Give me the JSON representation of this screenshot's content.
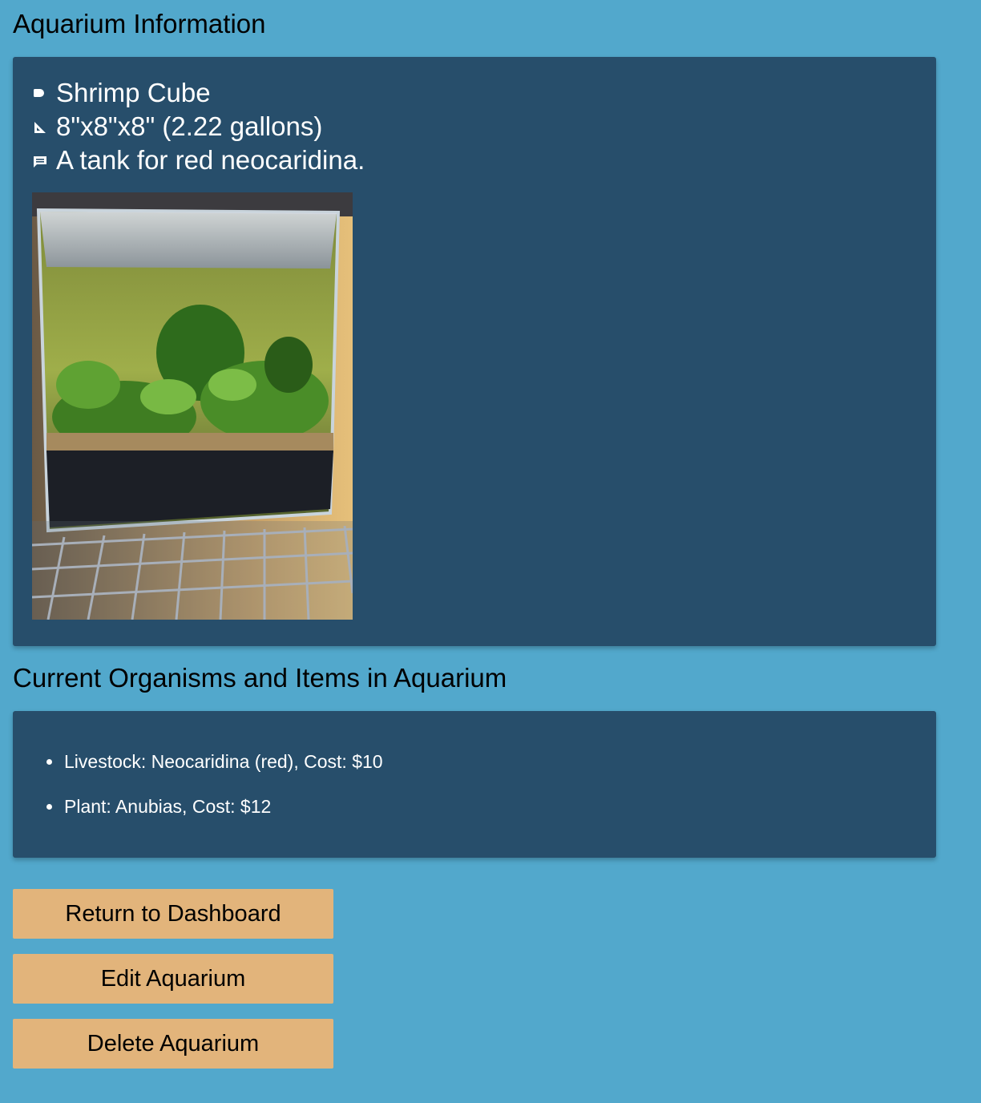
{
  "info_section": {
    "title": "Aquarium Information",
    "name": "Shrimp Cube",
    "dimensions": "8\"x8\"x8\" (2.22 gallons)",
    "description": "A tank for red neocaridina.",
    "icons": {
      "name": "label-icon",
      "dimensions": "ruler-icon",
      "description": "comment-icon"
    }
  },
  "items_section": {
    "title": "Current Organisms and Items in Aquarium",
    "items": [
      {
        "text": "Livestock: Neocaridina (red), Cost: $10"
      },
      {
        "text": "Plant: Anubias, Cost: $12"
      }
    ]
  },
  "buttons": {
    "return_label": "Return to Dashboard",
    "edit_label": "Edit Aquarium",
    "delete_label": "Delete Aquarium"
  },
  "colors": {
    "background": "#52a8cc",
    "panel": "#274e6b",
    "button": "#e2b47b"
  }
}
